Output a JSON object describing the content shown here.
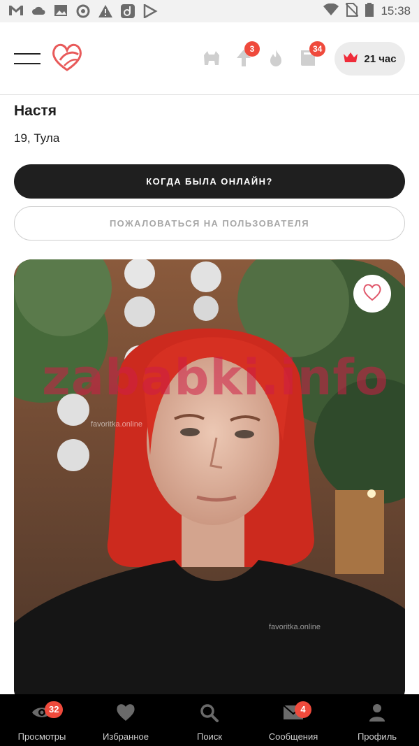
{
  "status_bar": {
    "time": "15:38",
    "left_icons": [
      "gmail-icon",
      "cloud-icon",
      "image-icon",
      "sync-icon",
      "warning-icon",
      "app-icon",
      "play-store-icon"
    ],
    "right_icons": [
      "wifi-icon",
      "no-sim-icon",
      "battery-icon"
    ]
  },
  "header": {
    "icons": [
      {
        "name": "kitty-icon",
        "badge": null
      },
      {
        "name": "boost-icon",
        "badge": "3"
      },
      {
        "name": "fire-icon",
        "badge": null
      },
      {
        "name": "book-icon",
        "badge": "34"
      }
    ],
    "boost_badge": "3",
    "book_badge": "34",
    "premium_label": "21 час",
    "accent_color": "#ef4a3c"
  },
  "profile": {
    "name": "Настя",
    "age_city": "19, Тула",
    "online_button": "КОГДА БЫЛА ОНЛАЙН?",
    "report_button": "ПОЖАЛОВАТЬСЯ НА ПОЛЬЗОВАТЕЛЯ"
  },
  "photo": {
    "watermark": "zababki.info",
    "watermark_small_1": "favoritka.online",
    "watermark_small_2": "favoritka.online"
  },
  "bottom_nav": {
    "items": [
      {
        "label": "Просмотры",
        "icon": "eye-icon",
        "badge": "32"
      },
      {
        "label": "Избранное",
        "icon": "heart-icon",
        "badge": null
      },
      {
        "label": "Поиск",
        "icon": "search-icon",
        "badge": null
      },
      {
        "label": "Сообщения",
        "icon": "envelope-icon",
        "badge": "4"
      },
      {
        "label": "Профиль",
        "icon": "user-icon",
        "badge": null
      }
    ]
  }
}
